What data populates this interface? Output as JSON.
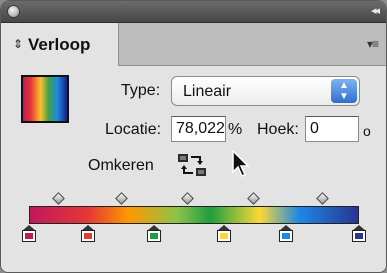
{
  "panel": {
    "collapse_glyph": "◂◂",
    "tab_arrows": "⇕",
    "tab_title": "Verloop",
    "menu_glyph": "▾≡"
  },
  "gradient": {
    "type_label": "Type:",
    "type_value": "Lineair",
    "location_label": "Locatie:",
    "location_value": "78,022",
    "location_unit": "%",
    "angle_label": "Hoek:",
    "angle_value": "0",
    "angle_unit": "o",
    "reverse_label": "Omkeren",
    "stops": [
      {
        "color": "#c2185b",
        "location_pct": 0
      },
      {
        "color": "#e53935",
        "location_pct": 18
      },
      {
        "color": "#1e9e3e",
        "location_pct": 38
      },
      {
        "color": "#fdd835",
        "location_pct": 59
      },
      {
        "color": "#1e88e5",
        "location_pct": 78
      },
      {
        "color": "#283593",
        "location_pct": 100
      }
    ],
    "midpoints_pct": [
      9,
      28,
      48,
      68,
      89
    ]
  },
  "icons": {
    "close": "close-icon",
    "collapse": "collapse-icon",
    "panel_menu": "panel-menu-icon",
    "reverse": "reverse-gradient-icon",
    "cursor": "mouse-pointer-icon"
  }
}
